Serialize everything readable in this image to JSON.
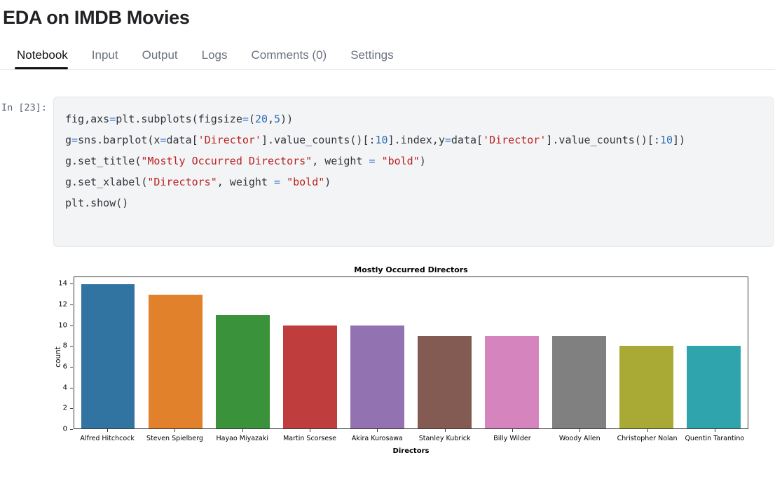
{
  "header": {
    "title": "EDA on IMDB Movies",
    "tabs": [
      {
        "label": "Notebook",
        "active": true
      },
      {
        "label": "Input",
        "active": false
      },
      {
        "label": "Output",
        "active": false
      },
      {
        "label": "Logs",
        "active": false
      },
      {
        "label": "Comments (0)",
        "active": false
      },
      {
        "label": "Settings",
        "active": false
      }
    ]
  },
  "cell": {
    "prompt": "In [23]:",
    "execution_count": 23,
    "code_lines": [
      "fig,axs=plt.subplots(figsize=(20,5))",
      "g=sns.barplot(x=data['Director'].value_counts()[:10].index,y=data['Director'].value_counts()[:10])",
      "g.set_title(\"Mostly Occurred Directors\", weight = \"bold\")",
      "g.set_xlabel(\"Directors\", weight = \"bold\")",
      "plt.show()"
    ]
  },
  "chart_data": {
    "type": "bar",
    "title": "Mostly Occurred Directors",
    "xlabel": "Directors",
    "ylabel": "count",
    "categories": [
      "Alfred Hitchcock",
      "Steven Spielberg",
      "Hayao Miyazaki",
      "Martin Scorsese",
      "Akira Kurosawa",
      "Stanley Kubrick",
      "Billy Wilder",
      "Woody Allen",
      "Christopher Nolan",
      "Quentin Tarantino"
    ],
    "values": [
      14,
      13,
      11,
      10,
      10,
      9,
      9,
      9,
      8,
      8
    ],
    "colors": [
      "#3274a1",
      "#e1812c",
      "#3a923a",
      "#c03d3e",
      "#9372b2",
      "#845b53",
      "#d684bd",
      "#808080",
      "#a9aa35",
      "#2fa4ad"
    ],
    "ylim": [
      0,
      14.7
    ],
    "yticks": [
      0,
      2,
      4,
      6,
      8,
      10,
      12,
      14
    ],
    "ytick_labels": [
      "0",
      "2",
      "4",
      "6",
      "8",
      "10",
      "12",
      "14"
    ],
    "grid": false,
    "legend": false
  },
  "style": {
    "cell_background": "#f3f4f5",
    "accent": "#111214",
    "string_color": "#ba2121",
    "number_color": "#2a6db5",
    "operator_color": "#3b74d6"
  }
}
